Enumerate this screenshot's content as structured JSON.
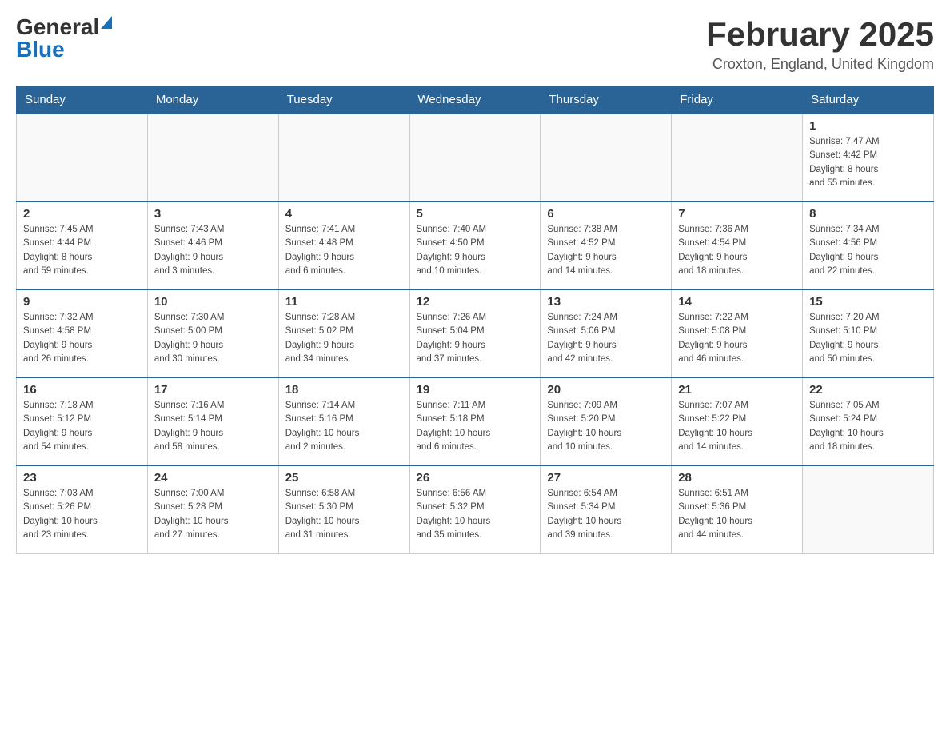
{
  "header": {
    "logo_general": "General",
    "logo_blue": "Blue",
    "title": "February 2025",
    "subtitle": "Croxton, England, United Kingdom"
  },
  "weekdays": [
    "Sunday",
    "Monday",
    "Tuesday",
    "Wednesday",
    "Thursday",
    "Friday",
    "Saturday"
  ],
  "weeks": [
    [
      {
        "day": "",
        "info": ""
      },
      {
        "day": "",
        "info": ""
      },
      {
        "day": "",
        "info": ""
      },
      {
        "day": "",
        "info": ""
      },
      {
        "day": "",
        "info": ""
      },
      {
        "day": "",
        "info": ""
      },
      {
        "day": "1",
        "info": "Sunrise: 7:47 AM\nSunset: 4:42 PM\nDaylight: 8 hours\nand 55 minutes."
      }
    ],
    [
      {
        "day": "2",
        "info": "Sunrise: 7:45 AM\nSunset: 4:44 PM\nDaylight: 8 hours\nand 59 minutes."
      },
      {
        "day": "3",
        "info": "Sunrise: 7:43 AM\nSunset: 4:46 PM\nDaylight: 9 hours\nand 3 minutes."
      },
      {
        "day": "4",
        "info": "Sunrise: 7:41 AM\nSunset: 4:48 PM\nDaylight: 9 hours\nand 6 minutes."
      },
      {
        "day": "5",
        "info": "Sunrise: 7:40 AM\nSunset: 4:50 PM\nDaylight: 9 hours\nand 10 minutes."
      },
      {
        "day": "6",
        "info": "Sunrise: 7:38 AM\nSunset: 4:52 PM\nDaylight: 9 hours\nand 14 minutes."
      },
      {
        "day": "7",
        "info": "Sunrise: 7:36 AM\nSunset: 4:54 PM\nDaylight: 9 hours\nand 18 minutes."
      },
      {
        "day": "8",
        "info": "Sunrise: 7:34 AM\nSunset: 4:56 PM\nDaylight: 9 hours\nand 22 minutes."
      }
    ],
    [
      {
        "day": "9",
        "info": "Sunrise: 7:32 AM\nSunset: 4:58 PM\nDaylight: 9 hours\nand 26 minutes."
      },
      {
        "day": "10",
        "info": "Sunrise: 7:30 AM\nSunset: 5:00 PM\nDaylight: 9 hours\nand 30 minutes."
      },
      {
        "day": "11",
        "info": "Sunrise: 7:28 AM\nSunset: 5:02 PM\nDaylight: 9 hours\nand 34 minutes."
      },
      {
        "day": "12",
        "info": "Sunrise: 7:26 AM\nSunset: 5:04 PM\nDaylight: 9 hours\nand 37 minutes."
      },
      {
        "day": "13",
        "info": "Sunrise: 7:24 AM\nSunset: 5:06 PM\nDaylight: 9 hours\nand 42 minutes."
      },
      {
        "day": "14",
        "info": "Sunrise: 7:22 AM\nSunset: 5:08 PM\nDaylight: 9 hours\nand 46 minutes."
      },
      {
        "day": "15",
        "info": "Sunrise: 7:20 AM\nSunset: 5:10 PM\nDaylight: 9 hours\nand 50 minutes."
      }
    ],
    [
      {
        "day": "16",
        "info": "Sunrise: 7:18 AM\nSunset: 5:12 PM\nDaylight: 9 hours\nand 54 minutes."
      },
      {
        "day": "17",
        "info": "Sunrise: 7:16 AM\nSunset: 5:14 PM\nDaylight: 9 hours\nand 58 minutes."
      },
      {
        "day": "18",
        "info": "Sunrise: 7:14 AM\nSunset: 5:16 PM\nDaylight: 10 hours\nand 2 minutes."
      },
      {
        "day": "19",
        "info": "Sunrise: 7:11 AM\nSunset: 5:18 PM\nDaylight: 10 hours\nand 6 minutes."
      },
      {
        "day": "20",
        "info": "Sunrise: 7:09 AM\nSunset: 5:20 PM\nDaylight: 10 hours\nand 10 minutes."
      },
      {
        "day": "21",
        "info": "Sunrise: 7:07 AM\nSunset: 5:22 PM\nDaylight: 10 hours\nand 14 minutes."
      },
      {
        "day": "22",
        "info": "Sunrise: 7:05 AM\nSunset: 5:24 PM\nDaylight: 10 hours\nand 18 minutes."
      }
    ],
    [
      {
        "day": "23",
        "info": "Sunrise: 7:03 AM\nSunset: 5:26 PM\nDaylight: 10 hours\nand 23 minutes."
      },
      {
        "day": "24",
        "info": "Sunrise: 7:00 AM\nSunset: 5:28 PM\nDaylight: 10 hours\nand 27 minutes."
      },
      {
        "day": "25",
        "info": "Sunrise: 6:58 AM\nSunset: 5:30 PM\nDaylight: 10 hours\nand 31 minutes."
      },
      {
        "day": "26",
        "info": "Sunrise: 6:56 AM\nSunset: 5:32 PM\nDaylight: 10 hours\nand 35 minutes."
      },
      {
        "day": "27",
        "info": "Sunrise: 6:54 AM\nSunset: 5:34 PM\nDaylight: 10 hours\nand 39 minutes."
      },
      {
        "day": "28",
        "info": "Sunrise: 6:51 AM\nSunset: 5:36 PM\nDaylight: 10 hours\nand 44 minutes."
      },
      {
        "day": "",
        "info": ""
      }
    ]
  ]
}
